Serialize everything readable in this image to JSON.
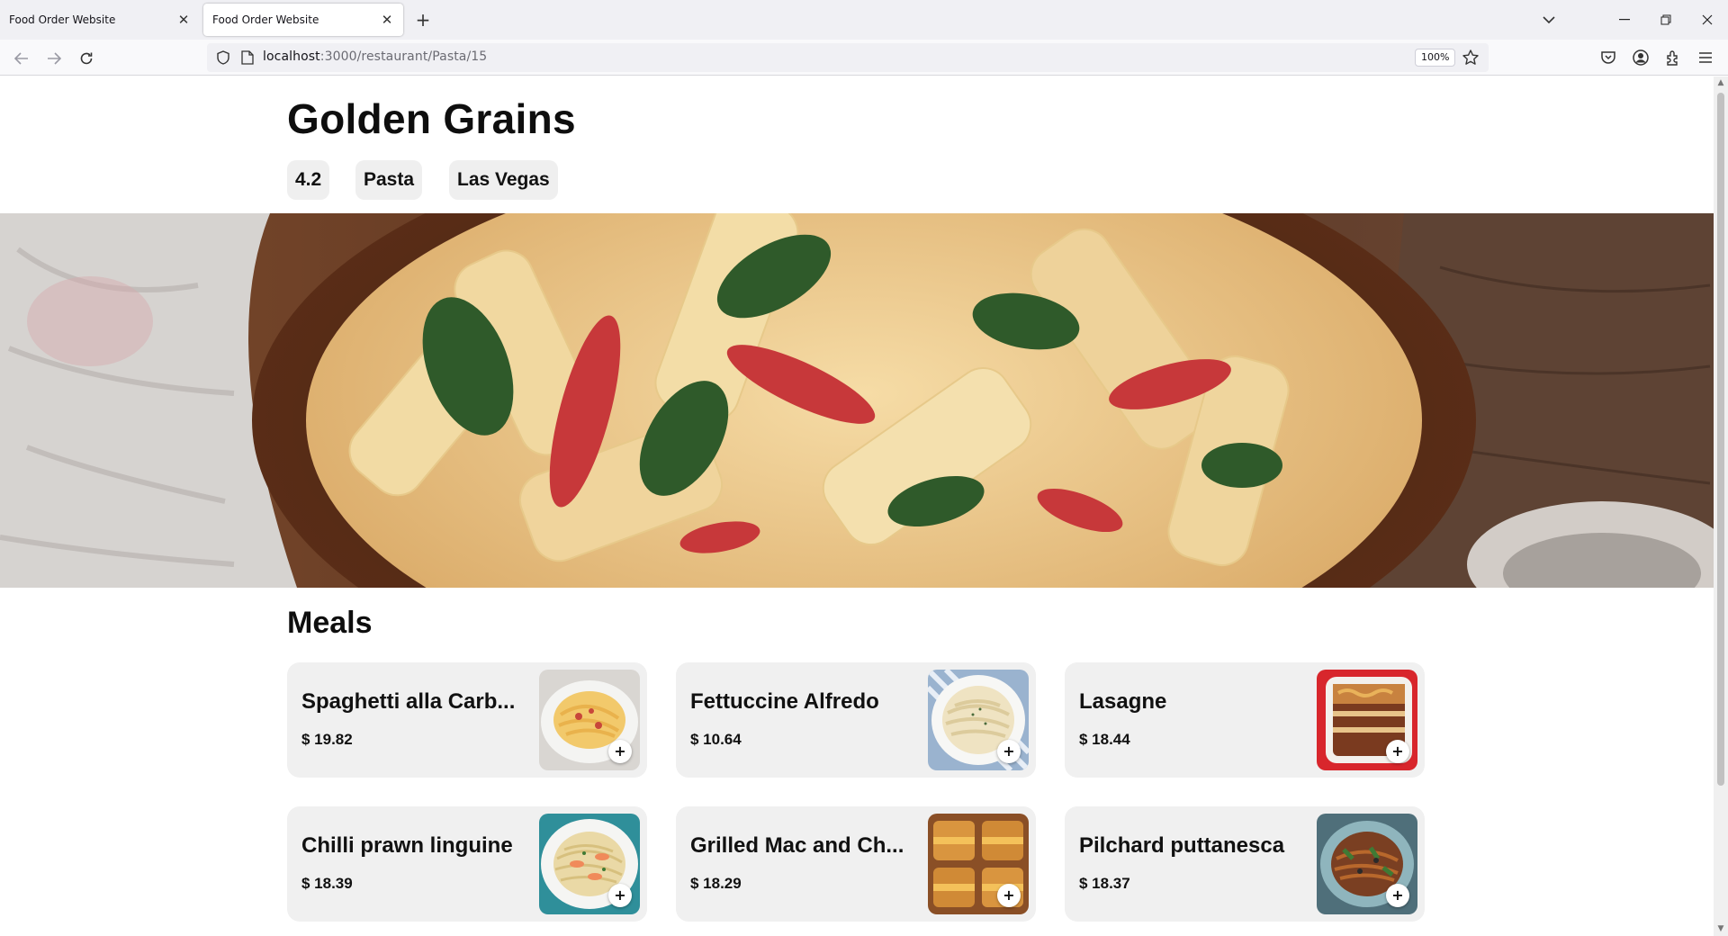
{
  "browser": {
    "tabs": [
      {
        "title": "Food Order Website",
        "active": false
      },
      {
        "title": "Food Order Website",
        "active": true
      }
    ],
    "url_host": "localhost",
    "url_path": ":3000/restaurant/Pasta/15",
    "zoom": "100%"
  },
  "restaurant": {
    "name": "Golden Grains",
    "rating": "4.2",
    "cuisine": "Pasta",
    "city": "Las Vegas"
  },
  "meals_section": {
    "title": "Meals",
    "add_label": "+",
    "items": [
      {
        "name": "Spaghetti alla Carb...",
        "price": "$ 19.82",
        "image": "spaghetti-carbonara-photo"
      },
      {
        "name": "Fettuccine Alfredo",
        "price": "$ 10.64",
        "image": "fettuccine-alfredo-photo"
      },
      {
        "name": "Lasagne",
        "price": "$ 18.44",
        "image": "lasagne-photo"
      },
      {
        "name": "Chilli prawn linguine",
        "price": "$ 18.39",
        "image": "prawn-linguine-photo"
      },
      {
        "name": "Grilled Mac and Ch...",
        "price": "$ 18.29",
        "image": "grilled-mac-cheese-photo"
      },
      {
        "name": "Pilchard puttanesca",
        "price": "$ 18.37",
        "image": "pilchard-puttanesca-photo"
      }
    ]
  },
  "colors": {
    "card_bg": "#f0f0f0",
    "chip_bg": "#efefef",
    "text": "#111111"
  }
}
